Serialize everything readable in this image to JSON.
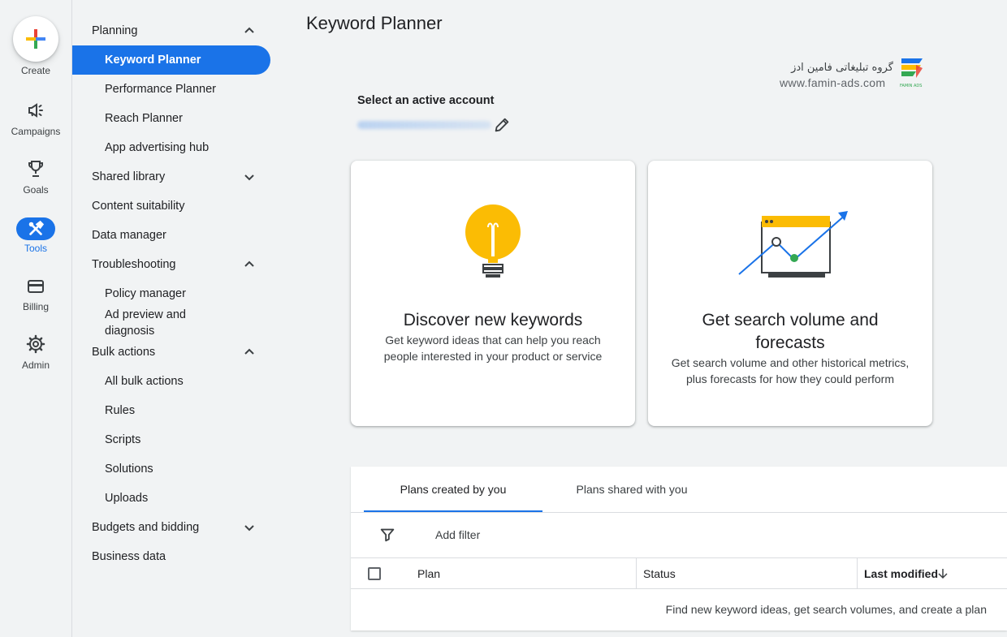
{
  "rail": {
    "create": "Create",
    "campaigns": "Campaigns",
    "goals": "Goals",
    "tools": "Tools",
    "billing": "Billing",
    "admin": "Admin"
  },
  "nav": {
    "planning": "Planning",
    "keyword_planner": "Keyword Planner",
    "performance_planner": "Performance Planner",
    "reach_planner": "Reach Planner",
    "app_advertising_hub": "App advertising hub",
    "shared_library": "Shared library",
    "content_suitability": "Content suitability",
    "data_manager": "Data manager",
    "troubleshooting": "Troubleshooting",
    "policy_manager": "Policy manager",
    "ad_preview_line1": "Ad preview and",
    "ad_preview_line2": "diagnosis",
    "bulk_actions": "Bulk actions",
    "all_bulk_actions": "All bulk actions",
    "rules": "Rules",
    "scripts": "Scripts",
    "solutions": "Solutions",
    "uploads": "Uploads",
    "budgets_and_bidding": "Budgets and bidding",
    "business_data": "Business data"
  },
  "header": {
    "title": "Keyword Planner"
  },
  "brand": {
    "name_fa": "گروه تبلیغاتی فامین ادز",
    "url": "www.famin-ads.com",
    "logo_text": "FAMIN ADS"
  },
  "account": {
    "label": "Select an active account"
  },
  "cards": {
    "discover": {
      "title": "Discover new keywords",
      "desc_line1": "Get keyword ideas that can help you reach",
      "desc_line2": "people interested in your product or service"
    },
    "forecast": {
      "title_line1": "Get search volume and",
      "title_line2": "forecasts",
      "desc_line1": "Get search volume and other historical metrics,",
      "desc_line2": "plus forecasts for how they could perform"
    }
  },
  "plans": {
    "tab_created": "Plans created by you",
    "tab_shared": "Plans shared with you",
    "add_filter": "Add filter",
    "col_plan": "Plan",
    "col_status": "Status",
    "col_last_modified": "Last modified",
    "empty_message": "Find new keyword ideas, get search volumes, and create a plan"
  },
  "colors": {
    "accent": "#1a73e8",
    "bulb": "#fbbc04",
    "green": "#34a853",
    "red": "#ea4335"
  }
}
